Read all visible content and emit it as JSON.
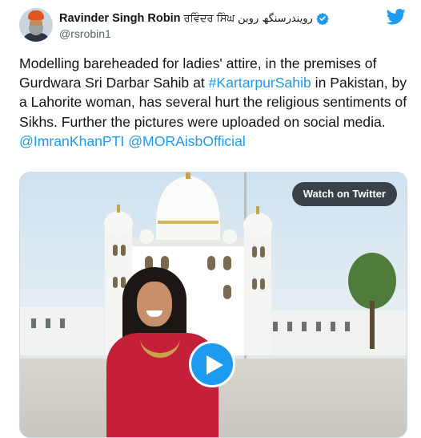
{
  "tweet": {
    "author_name": "Ravinder Singh Robin",
    "author_name_gurmukhi": "ਰਵਿੰਦਰ ਸਿੰਘ",
    "author_name_urdu": "رویندرسنگھ روبن",
    "handle": "@rsrobin1",
    "verified": true,
    "text_before": "Modelling bareheaded for ladies' attire, in the premises  of Gurdwara Sri Darbar Sahib at ",
    "hashtag": "#KartarpurSahib",
    "text_after": " in Pakistan, by a Lahorite woman,  has several hurt the religious sentiments of Sikhs. Further the pictures were uploaded on social media.",
    "mention_1": "@ImranKhanPTI",
    "mention_2": "@MORAisbOfficial"
  },
  "media": {
    "watch_label": "Watch on Twitter"
  },
  "icons": {
    "brand": "twitter-bird-icon",
    "verified": "verified-badge-icon",
    "play": "play-icon"
  },
  "colors": {
    "brand_blue": "#1d9bf0",
    "text": "#0f1419",
    "muted": "#536471"
  }
}
